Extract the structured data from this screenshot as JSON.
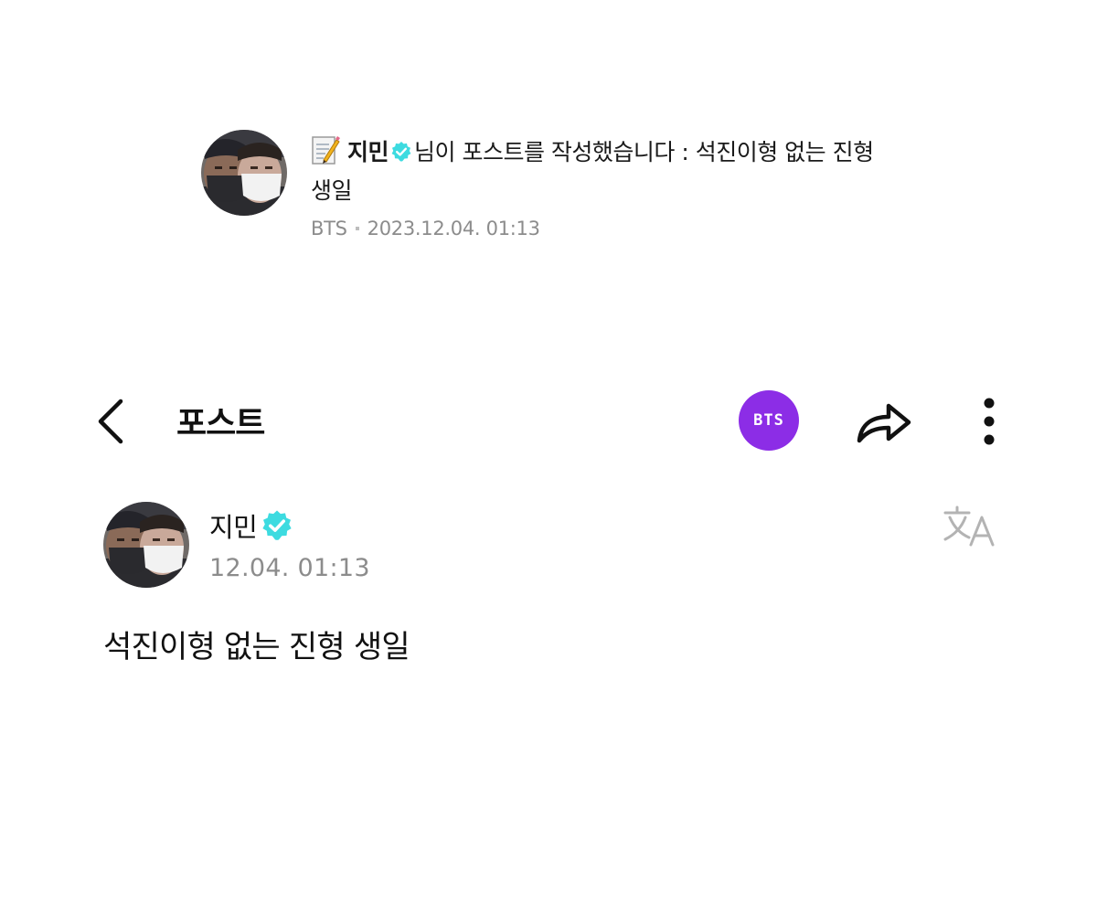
{
  "notification": {
    "icon": "memo-icon",
    "author": "지민",
    "message": "님이 포스트를 작성했습니다 : 석진이형 없는 진형 생일",
    "community": "BTS",
    "timestamp": "2023.12.04. 01:13"
  },
  "header": {
    "title": "포스트",
    "badge_label": "BTS",
    "badge_color": "#8c2de6"
  },
  "post": {
    "author": "지민",
    "date": "12.04. 01:13",
    "content": "석진이형 없는 진형 생일"
  },
  "colors": {
    "verified_badge": "#3ddbe0",
    "secondary_text": "#8c8c8c"
  }
}
